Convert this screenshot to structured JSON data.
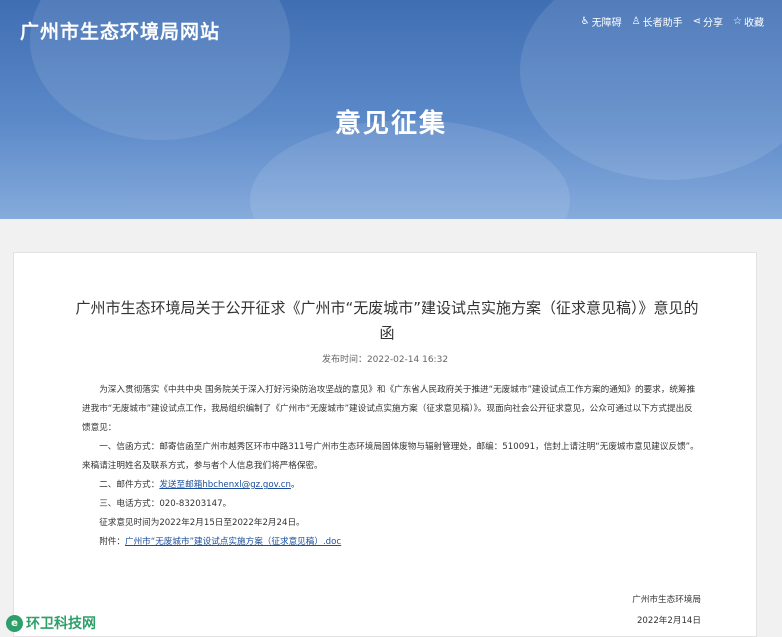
{
  "header": {
    "site_title": "广州市生态环境局网站",
    "tools": [
      {
        "icon": "accessibility-icon",
        "glyph": "♿",
        "label": "无障碍"
      },
      {
        "icon": "elder-icon",
        "glyph": "♙",
        "label": "长者助手"
      },
      {
        "icon": "share-icon",
        "glyph": "⋖",
        "label": "分享"
      },
      {
        "icon": "star-icon",
        "glyph": "☆",
        "label": "收藏"
      }
    ],
    "page_heading": "意见征集"
  },
  "article": {
    "title": "广州市生态环境局关于公开征求《广州市“无废城市”建设试点实施方案（征求意见稿）》意见的函",
    "publish_time": "发布时间：2022-02-14 16:32",
    "para1": "为深入贯彻落实《中共中央 国务院关于深入打好污染防治攻坚战的意见》和《广东省人民政府关于推进“无废城市”建设试点工作方案的通知》的要求，统筹推进我市“无废城市”建设试点工作，我局组织编制了《广州市“无废城市”建设试点实施方案（征求意见稿）》。现面向社会公开征求意见，公众可通过以下方式提出反馈意见：",
    "para2": "一、信函方式：邮寄信函至广州市越秀区环市中路311号广州市生态环境局固体废物与辐射管理处，邮编：510091，信封上请注明“无废城市意见建议反馈”。来稿请注明姓名及联系方式，参与者个人信息我们将严格保密。",
    "para3_prefix": "二、邮件方式：",
    "para3_link": "发送至邮箱hbchenxl@gz.gov.cn",
    "para3_suffix": "。",
    "para4": "三、电话方式：020-83203147。",
    "para5": "征求意见时间为2022年2月15日至2022年2月24日。",
    "attach_prefix": "附件：",
    "attach_link": "广州市“无废城市”建设试点实施方案（征求意见稿）.doc",
    "signature": "广州市生态环境局",
    "date": "2022年2月14日"
  },
  "watermark": {
    "logo_glyph": "e",
    "text": "环卫科技网"
  }
}
